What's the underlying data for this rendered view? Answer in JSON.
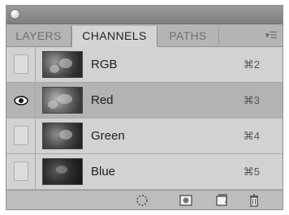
{
  "tabs": [
    {
      "label": "LAYERS"
    },
    {
      "label": "CHANNELS"
    },
    {
      "label": "PATHS"
    }
  ],
  "panel_menu_icon": "panel-menu-icon",
  "channels": [
    {
      "name": "RGB",
      "shortcut": "⌘2",
      "visible": false,
      "selected": false
    },
    {
      "name": "Red",
      "shortcut": "⌘3",
      "visible": true,
      "selected": true
    },
    {
      "name": "Green",
      "shortcut": "⌘4",
      "visible": false,
      "selected": false
    },
    {
      "name": "Blue",
      "shortcut": "⌘5",
      "visible": false,
      "selected": false
    }
  ],
  "bottom_tools": [
    {
      "icon": "load-selection-icon"
    },
    {
      "icon": "save-selection-icon"
    },
    {
      "icon": "new-channel-icon"
    },
    {
      "icon": "trash-icon"
    }
  ]
}
